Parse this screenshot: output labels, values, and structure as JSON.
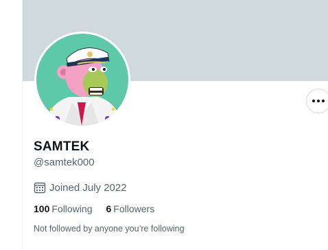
{
  "profile": {
    "display_name": "SAMTEK",
    "handle": "@samtek000",
    "joined": "Joined July 2022",
    "avatar_alt": "avatar"
  },
  "stats": {
    "following_count": "100",
    "following_label": "Following",
    "followers_count": "6",
    "followers_label": "Followers"
  },
  "social_context": "Not followed by anyone you’re following",
  "icons": {
    "more": "more-horizontal-icon",
    "joined": "calendar-icon"
  },
  "colors": {
    "banner": "#cfd9de",
    "text_primary": "#0f1419",
    "text_secondary": "#536471",
    "avatar_bg": "#5ec9a8"
  }
}
